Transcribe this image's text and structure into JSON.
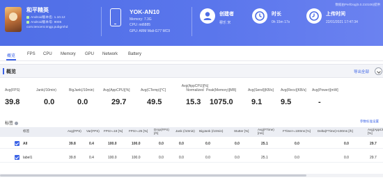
{
  "app": {
    "name": "和平精英",
    "android_version_name": "Android版本名: 1.10.12",
    "android_version_code": "Android版本号: 9005",
    "package": "com.tencent.tmgp.pubgmhd"
  },
  "device": {
    "name": "YOK-AN10",
    "memory": "Memory: 7.3G",
    "cpu": "CPU: mt6885",
    "gpu": "GPU: ARM Mali-G77 MC9"
  },
  "creator": {
    "label": "创建者",
    "value": "穆乐 宋"
  },
  "duration": {
    "label": "时长",
    "value": "0h 15m 17s"
  },
  "upload": {
    "label": "上传时间",
    "value": "22/01/2021 17:47:34"
  },
  "top_right_note": "数据由PerfDog(5.0.210106)提供",
  "tabs": [
    "概览",
    "FPS",
    "CPU",
    "Memory",
    "GPU",
    "Network",
    "Battery"
  ],
  "overview": {
    "title": "概览",
    "export": "导出全部",
    "metrics": [
      {
        "label": "Avg(FPS)",
        "value": "39.8"
      },
      {
        "label": "Jank(/10min)",
        "value": "0.0"
      },
      {
        "label": "BigJank(/10min)",
        "value": "0.0"
      },
      {
        "label": "Avg(AppCPU)[%]",
        "value": "29.7"
      },
      {
        "label": "Avg(CTemp)[℃]",
        "value": "49.5"
      },
      {
        "label": "Avg(AppCPU)[%] Normalized",
        "value": "15.3"
      },
      {
        "label": "Peak(Memory)[MB]",
        "value": "1075.0"
      },
      {
        "label": "Avg(Send)[KB/s]",
        "value": "9.1"
      },
      {
        "label": "Avg(Recv)[KB/s]",
        "value": "9.5"
      },
      {
        "label": "Avg(Power)[mW]",
        "value": "-"
      }
    ]
  },
  "table": {
    "title": "标签",
    "param_link": "参数标准设置",
    "headers": [
      "标签",
      "Avg(FPS)",
      "Var(FPS)",
      "FPS>=18 [%]",
      "FPS>=25 [%]",
      "Drop(FPS) [/h]",
      "Jank (/10min)",
      "BigJank (/10min)",
      "Stutter [%]",
      "Avg(FTime) [ms]",
      "FTime>=100ms [%]",
      "Delta(FTime)>100ms [/h]",
      "Avg(AppCP [%]"
    ],
    "rows": [
      [
        "All",
        "39.8",
        "0.4",
        "100.0",
        "100.0",
        "0.0",
        "0.0",
        "0.0",
        "0.0",
        "25.1",
        "0.0",
        "0.0",
        "29.7"
      ],
      [
        "label1",
        "39.8",
        "0.4",
        "100.0",
        "100.0",
        "0.0",
        "0.0",
        "0.0",
        "0.0",
        "25.1",
        "0.0",
        "0.0",
        "29.7"
      ]
    ]
  },
  "colors": {
    "accent": "#3c63e6",
    "header_bg": "#5a76ec"
  }
}
